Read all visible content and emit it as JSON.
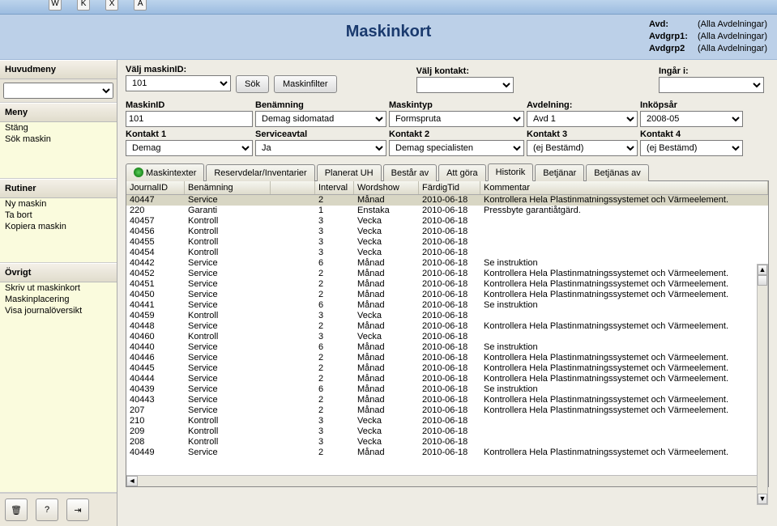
{
  "toolbar_letters": [
    "W",
    "K",
    "X",
    "A"
  ],
  "header": {
    "title": "Maskinkort",
    "info": [
      {
        "label": "Avd:",
        "value": "(Alla Avdelningar)"
      },
      {
        "label": "Avdgrp1:",
        "value": "(Alla Avdelningar)"
      },
      {
        "label": "Avdgrp2",
        "value": "(Alla Avdelningar)"
      }
    ]
  },
  "sidebar": {
    "huvudmeny": "Huvudmeny",
    "meny_head": "Meny",
    "meny_items": [
      "Stäng",
      "Sök maskin"
    ],
    "rutiner_head": "Rutiner",
    "rutiner_items": [
      "Ny maskin",
      "Ta bort",
      "Kopiera maskin"
    ],
    "ovrigt_head": "Övrigt",
    "ovrigt_items": [
      "Skriv ut maskinkort",
      "Maskinplacering",
      "Visa journalöversikt"
    ]
  },
  "filters": {
    "valj_maskin_lbl": "Välj maskinID:",
    "valj_maskin_val": "101",
    "sok_btn": "Sök",
    "maskinfilter_btn": "Maskinfilter",
    "valj_kontakt_lbl": "Välj kontakt:",
    "valj_kontakt_val": "",
    "ingar_lbl": "Ingår i:",
    "ingar_val": ""
  },
  "form": {
    "r1": [
      {
        "lbl": "MaskinID",
        "val": "101",
        "type": "input"
      },
      {
        "lbl": "Benämning",
        "val": "Demag sidomatad",
        "type": "select"
      },
      {
        "lbl": "Maskintyp",
        "val": "Formspruta",
        "type": "select"
      },
      {
        "lbl": "Avdelning:",
        "val": "Avd 1",
        "type": "select"
      },
      {
        "lbl": "Inköpsår",
        "val": "2008-05",
        "type": "select"
      }
    ],
    "r2": [
      {
        "lbl": "Kontakt 1",
        "val": "Demag",
        "type": "select"
      },
      {
        "lbl": "Serviceavtal",
        "val": "Ja",
        "type": "select"
      },
      {
        "lbl": "Kontakt 2",
        "val": "Demag specialisten",
        "type": "select"
      },
      {
        "lbl": "Kontakt 3",
        "val": "(ej Bestämd)",
        "type": "select"
      },
      {
        "lbl": "Kontakt 4",
        "val": "(ej Bestämd)",
        "type": "select"
      }
    ]
  },
  "tabs": [
    "Maskintexter",
    "Reservdelar/Inventarier",
    "Planerat UH",
    "Består av",
    "Att göra",
    "Historik",
    "Betjänar",
    "Betjänas av"
  ],
  "active_tab": "Historik",
  "grid": {
    "columns": [
      "JournalID",
      "Benämning",
      "Interval",
      "Wordshow",
      "FärdigTid",
      "Kommentar"
    ],
    "rows": [
      {
        "id": "40447",
        "ben": "Service",
        "int": "2",
        "ws": "Månad",
        "ft": "2010-06-18",
        "kom": "Kontrollera Hela Plastinmatningssystemet och Värmeelement."
      },
      {
        "id": "220",
        "ben": "Garanti",
        "int": "1",
        "ws": "Enstaka",
        "ft": "2010-06-18",
        "kom": "Pressbyte garantiåtgärd."
      },
      {
        "id": "40457",
        "ben": "Kontroll",
        "int": "3",
        "ws": "Vecka",
        "ft": "2010-06-18",
        "kom": ""
      },
      {
        "id": "40456",
        "ben": "Kontroll",
        "int": "3",
        "ws": "Vecka",
        "ft": "2010-06-18",
        "kom": ""
      },
      {
        "id": "40455",
        "ben": "Kontroll",
        "int": "3",
        "ws": "Vecka",
        "ft": "2010-06-18",
        "kom": ""
      },
      {
        "id": "40454",
        "ben": "Kontroll",
        "int": "3",
        "ws": "Vecka",
        "ft": "2010-06-18",
        "kom": ""
      },
      {
        "id": "40442",
        "ben": "Service",
        "int": "6",
        "ws": "Månad",
        "ft": "2010-06-18",
        "kom": "Se instruktion"
      },
      {
        "id": "40452",
        "ben": "Service",
        "int": "2",
        "ws": "Månad",
        "ft": "2010-06-18",
        "kom": "Kontrollera Hela Plastinmatningssystemet och Värmeelement."
      },
      {
        "id": "40451",
        "ben": "Service",
        "int": "2",
        "ws": "Månad",
        "ft": "2010-06-18",
        "kom": "Kontrollera Hela Plastinmatningssystemet och Värmeelement."
      },
      {
        "id": "40450",
        "ben": "Service",
        "int": "2",
        "ws": "Månad",
        "ft": "2010-06-18",
        "kom": "Kontrollera Hela Plastinmatningssystemet och Värmeelement."
      },
      {
        "id": "40441",
        "ben": "Service",
        "int": "6",
        "ws": "Månad",
        "ft": "2010-06-18",
        "kom": "Se instruktion"
      },
      {
        "id": "40459",
        "ben": "Kontroll",
        "int": "3",
        "ws": "Vecka",
        "ft": "2010-06-18",
        "kom": ""
      },
      {
        "id": "40448",
        "ben": "Service",
        "int": "2",
        "ws": "Månad",
        "ft": "2010-06-18",
        "kom": "Kontrollera Hela Plastinmatningssystemet och Värmeelement."
      },
      {
        "id": "40460",
        "ben": "Kontroll",
        "int": "3",
        "ws": "Vecka",
        "ft": "2010-06-18",
        "kom": ""
      },
      {
        "id": "40440",
        "ben": "Service",
        "int": "6",
        "ws": "Månad",
        "ft": "2010-06-18",
        "kom": "Se instruktion"
      },
      {
        "id": "40446",
        "ben": "Service",
        "int": "2",
        "ws": "Månad",
        "ft": "2010-06-18",
        "kom": "Kontrollera Hela Plastinmatningssystemet och Värmeelement."
      },
      {
        "id": "40445",
        "ben": "Service",
        "int": "2",
        "ws": "Månad",
        "ft": "2010-06-18",
        "kom": "Kontrollera Hela Plastinmatningssystemet och Värmeelement."
      },
      {
        "id": "40444",
        "ben": "Service",
        "int": "2",
        "ws": "Månad",
        "ft": "2010-06-18",
        "kom": "Kontrollera Hela Plastinmatningssystemet och Värmeelement."
      },
      {
        "id": "40439",
        "ben": "Service",
        "int": "6",
        "ws": "Månad",
        "ft": "2010-06-18",
        "kom": "Se instruktion"
      },
      {
        "id": "40443",
        "ben": "Service",
        "int": "2",
        "ws": "Månad",
        "ft": "2010-06-18",
        "kom": "Kontrollera Hela Plastinmatningssystemet och Värmeelement."
      },
      {
        "id": "207",
        "ben": "Service",
        "int": "2",
        "ws": "Månad",
        "ft": "2010-06-18",
        "kom": "Kontrollera Hela Plastinmatningssystemet och Värmeelement."
      },
      {
        "id": "210",
        "ben": "Kontroll",
        "int": "3",
        "ws": "Vecka",
        "ft": "2010-06-18",
        "kom": ""
      },
      {
        "id": "209",
        "ben": "Kontroll",
        "int": "3",
        "ws": "Vecka",
        "ft": "2010-06-18",
        "kom": ""
      },
      {
        "id": "208",
        "ben": "Kontroll",
        "int": "3",
        "ws": "Vecka",
        "ft": "2010-06-18",
        "kom": ""
      },
      {
        "id": "40449",
        "ben": "Service",
        "int": "2",
        "ws": "Månad",
        "ft": "2010-06-18",
        "kom": "Kontrollera Hela Plastinmatningssystemet och Värmeelement."
      }
    ]
  },
  "icons": {
    "trash": "🗑",
    "help": "?",
    "exit": "⇥"
  }
}
